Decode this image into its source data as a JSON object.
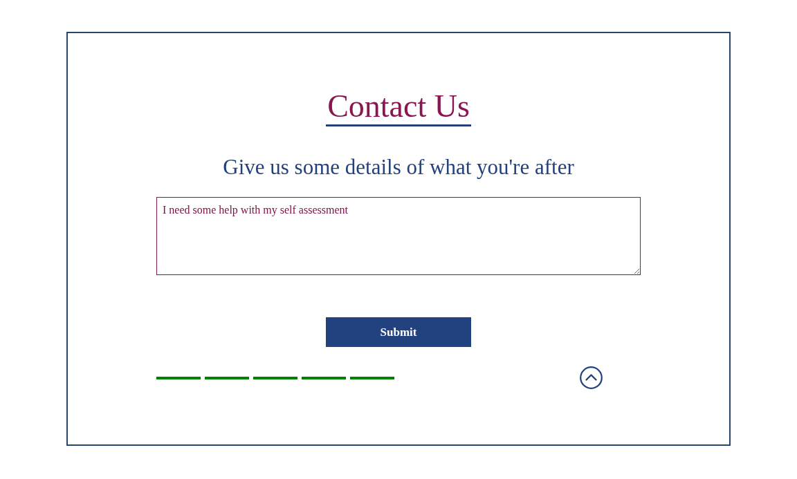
{
  "heading": {
    "title": "Contact Us",
    "subtitle": "Give us some details of what you're after"
  },
  "form": {
    "message": {
      "value": "I need some help with my self assessment"
    },
    "submit": {
      "label": "Submit"
    }
  },
  "segment_bar": {
    "segments": [
      {
        "on": true
      },
      {
        "on": true
      },
      {
        "on": true
      },
      {
        "on": true
      },
      {
        "on": true
      }
    ]
  }
}
